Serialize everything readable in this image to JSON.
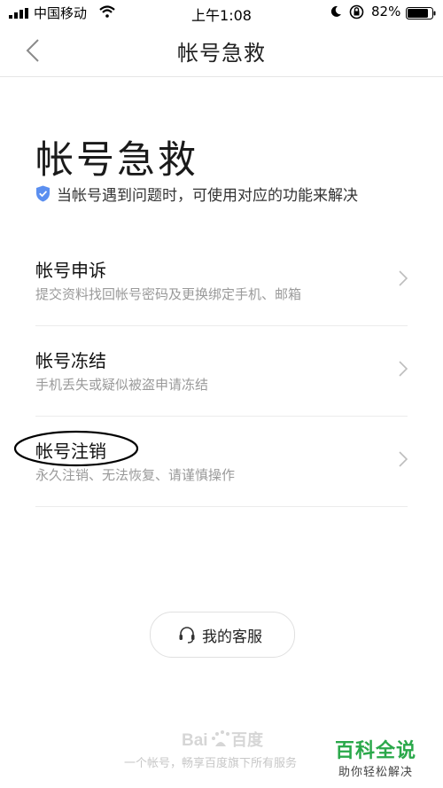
{
  "status_bar": {
    "carrier": "中国移动",
    "time": "上午1:08",
    "battery": "82%"
  },
  "nav": {
    "title": "帐号急救"
  },
  "hero": {
    "title": "帐号急救",
    "subtitle": "当帐号遇到问题时，可使用对应的功能来解决"
  },
  "items": [
    {
      "title": "帐号申诉",
      "desc": "提交资料找回帐号密码及更换绑定手机、邮箱"
    },
    {
      "title": "帐号冻结",
      "desc": "手机丢失或疑似被盗申请冻结"
    },
    {
      "title": "帐号注销",
      "desc": "永久注销、无法恢复、请谨慎操作"
    }
  ],
  "service_button": {
    "label": "我的客服"
  },
  "footer": {
    "text": "一个帐号，畅享百度旗下所有服务",
    "logo_label": "Bai百度"
  },
  "watermark": {
    "title": "百科全说",
    "subtitle": "助你轻松解决"
  },
  "colors": {
    "accent_blue": "#5b8ff0",
    "watermark_green": "#2aa84a"
  },
  "icons": [
    "signal-icon",
    "wifi-icon",
    "moon-icon",
    "orientation-lock-icon",
    "battery-icon",
    "back-arrow-icon",
    "shield-check-icon",
    "chevron-right-icon",
    "headset-icon"
  ]
}
